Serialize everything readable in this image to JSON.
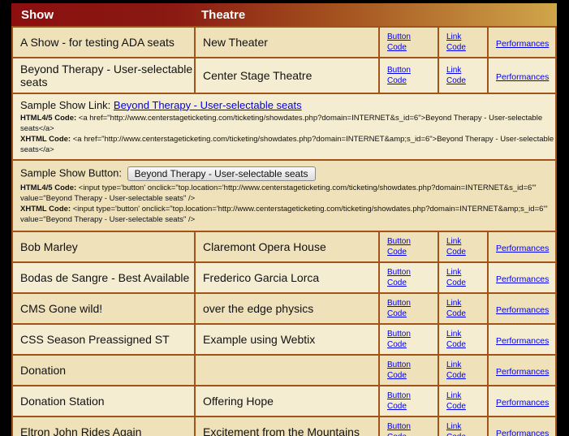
{
  "header": {
    "show": "Show",
    "theatre": "Theatre"
  },
  "labels": {
    "button_code": [
      "Button",
      "Code"
    ],
    "link_code": [
      "Link",
      "Code"
    ],
    "performances": "Performances"
  },
  "rows_before": [
    {
      "show": "A Show - for testing ADA seats",
      "theatre": "New Theater"
    },
    {
      "show": "Beyond Therapy - User-selectable seats",
      "theatre": "Center Stage Theatre"
    }
  ],
  "sample_link": {
    "label": "Sample Show Link:",
    "link_text": "Beyond Therapy - User-selectable seats",
    "html_label": "HTML4/5 Code:",
    "html_code": "<a href=\"http://www.centerstageticketing.com/ticketing/showdates.php?domain=INTERNET&s_id=6\">Beyond Therapy - User-selectable seats</a>",
    "xhtml_label": "XHTML Code:",
    "xhtml_code": "<a href=\"http://www.centerstageticketing.com/ticketing/showdates.php?domain=INTERNET&amp;s_id=6\">Beyond Therapy - User-selectable seats</a>"
  },
  "sample_button": {
    "label": "Sample Show Button:",
    "button_text": "Beyond Therapy - User-selectable seats",
    "html_label": "HTML4/5 Code:",
    "html_code": "<input type='button' onclick=\"top.location='http://www.centerstageticketing.com/ticketing/showdates.php?domain=INTERNET&s_id=6'\" value=\"Beyond Therapy - User-selectable seats\" />",
    "xhtml_label": "XHTML Code:",
    "xhtml_code": "<input type='button' onclick=\"top.location='http://www.centerstageticketing.com/ticketing/showdates.php?domain=INTERNET&amp;s_id=6'\" value=\"Beyond Therapy - User-selectable seats\" />"
  },
  "rows_after": [
    {
      "show": "Bob Marley",
      "theatre": "Claremont Opera House"
    },
    {
      "show": "Bodas de Sangre - Best Available",
      "theatre": "Frederico Garcia Lorca"
    },
    {
      "show": "CMS Gone wild!",
      "theatre": "over the edge physics"
    },
    {
      "show": "CSS Season Preassigned ST",
      "theatre": "Example using Webtix"
    },
    {
      "show": "Donation",
      "theatre": ""
    },
    {
      "show": "Donation Station",
      "theatre": "Offering Hope"
    },
    {
      "show": "Eltron John Rides Again",
      "theatre": "Excitement from the Mountains"
    }
  ],
  "colors": {
    "header_start": "#8b0f0f",
    "header_end": "#d0a64a",
    "border": "#a0541a",
    "row_odd": "#efe1b9",
    "row_even": "#f5edd2",
    "link": "#0000ee"
  }
}
